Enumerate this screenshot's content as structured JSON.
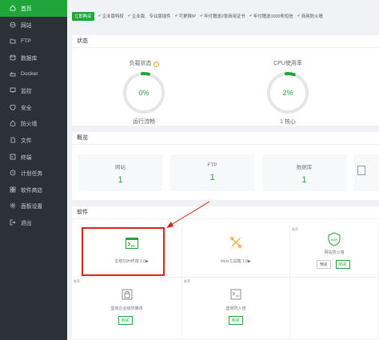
{
  "sidebar": {
    "items": [
      {
        "icon": "home-icon",
        "label": "首页",
        "active": true
      },
      {
        "icon": "globe-icon",
        "label": "网站"
      },
      {
        "icon": "folder-icon",
        "label": "FTP"
      },
      {
        "icon": "database-icon",
        "label": "数据库"
      },
      {
        "icon": "docker-icon",
        "label": "Docker"
      },
      {
        "icon": "monitor-icon",
        "label": "监控"
      },
      {
        "icon": "shield-icon",
        "label": "安全"
      },
      {
        "icon": "firewall-icon",
        "label": "防火墙"
      },
      {
        "icon": "file-icon",
        "label": "文件"
      },
      {
        "icon": "terminal-icon",
        "label": "终端"
      },
      {
        "icon": "clock-icon",
        "label": "计划任务"
      },
      {
        "icon": "store-icon",
        "label": "软件商店"
      },
      {
        "icon": "settings-icon",
        "label": "面板设置"
      },
      {
        "icon": "logout-icon",
        "label": "退出"
      }
    ]
  },
  "topbar": {
    "buy_label": "立即购买",
    "features": [
      "企业版特权",
      "企业版、专业版插件",
      "可更换IP",
      "年付赠送2张商用证书",
      "年付赠送1000条短信",
      "商用防火墙"
    ]
  },
  "status": {
    "title": "状态",
    "load": {
      "label": "负载状态",
      "value": "0%",
      "percent": 0,
      "sub": "运行流畅"
    },
    "cpu": {
      "label": "CPU使用率",
      "value": "2%",
      "percent": 2,
      "sub": "1 核心"
    }
  },
  "overview": {
    "title": "概览",
    "cards": [
      {
        "label": "网站",
        "value": "1"
      },
      {
        "label": "FTP",
        "value": "1"
      },
      {
        "label": "数据库",
        "value": "1"
      }
    ]
  },
  "software": {
    "title": "软件",
    "rec_tag": "推荐",
    "items": [
      {
        "name": "宝塔SSH终端 1.0▶"
      },
      {
        "name": "linux工具箱 1.8▶"
      },
      {
        "name": "网站防火墙",
        "btn1": "预览",
        "btn2": "购买"
      },
      {
        "name": "堡塔企业级防篡改",
        "btn1": "购买"
      },
      {
        "name": "堡塔防入侵",
        "btn1": "购买"
      }
    ]
  },
  "colors": {
    "accent": "#20a53a",
    "sidebar_bg": "#2c3138",
    "highlight": "#d9261c"
  }
}
